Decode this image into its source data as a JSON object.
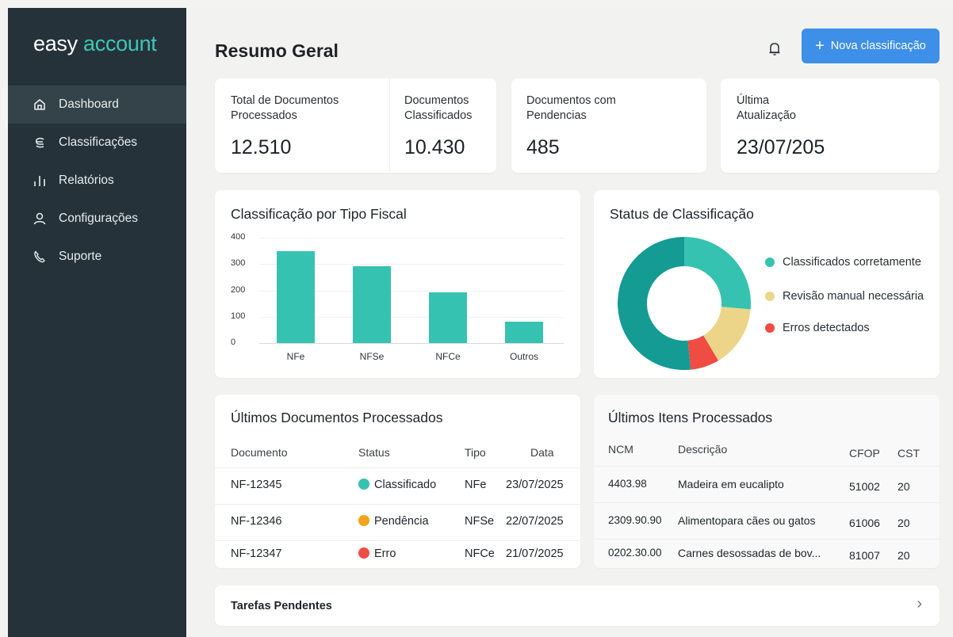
{
  "app": {
    "logo_a": "easy",
    "logo_b": "account"
  },
  "sidebar": {
    "items": [
      {
        "label": "Dashboard",
        "icon": "home-icon",
        "active": true
      },
      {
        "label": "Classificações",
        "icon": "tag-icon"
      },
      {
        "label": "Relatórios",
        "icon": "bar-chart-icon"
      },
      {
        "label": "Configurações",
        "icon": "user-icon"
      },
      {
        "label": "Suporte",
        "icon": "phone-icon"
      }
    ]
  },
  "header": {
    "title": "Resumo Geral",
    "new_button": "Nova classificação",
    "plus": "+"
  },
  "kpis": [
    {
      "label": "Total de Documentos Processados",
      "value": "12.510"
    },
    {
      "label": "Documentos Classificados",
      "value": "10.430"
    },
    {
      "label": "Documentos com Pendencias",
      "value": "485"
    },
    {
      "label": "Última Atualização",
      "value": "23/07/205"
    }
  ],
  "bar_chart": {
    "title": "Classificação por Tipo Fiscal",
    "chart_data": {
      "type": "bar",
      "categories": [
        "NFe",
        "NFSe",
        "NFCe",
        "Outros"
      ],
      "values": [
        350,
        292,
        192,
        82
      ],
      "ylim": [
        0,
        400
      ],
      "yticks": [
        "400",
        "300",
        "200",
        "100",
        "0"
      ],
      "color": "#36c2b0"
    }
  },
  "donut": {
    "title": "Status de Classificação",
    "chart_data": {
      "type": "pie",
      "categories": [
        "Classificados corretamente",
        "Revisão manual necessária",
        "Erros detectados"
      ],
      "values": [
        78,
        15,
        7
      ],
      "colors": [
        "#36c2b0",
        "#ecd588",
        "#ef4c43"
      ],
      "legend": "right"
    }
  },
  "docs_table": {
    "title": "Últimos Documentos Processados",
    "headers": [
      "Documento",
      "Status",
      "Tipo",
      "Data"
    ],
    "rows": [
      {
        "doc": "NF-12345",
        "status": "Classificado",
        "status_color": "#36c2b0",
        "tipo": "NFe",
        "data": "23/07/2025"
      },
      {
        "doc": "NF-12346",
        "status": "Pendência",
        "status_color": "#f3a41d",
        "tipo": "NFSe",
        "data": "22/07/2025"
      },
      {
        "doc": "NF-12347",
        "status": "Erro",
        "status_color": "#ef4c43",
        "tipo": "NFCe",
        "data": "21/07/2025"
      }
    ]
  },
  "items_table": {
    "title": "Últimos Itens Processados",
    "headers": [
      "NCM",
      "Descrição",
      "CFOP",
      "CST"
    ],
    "rows": [
      {
        "ncm": "4403.98",
        "desc": "Madeira em eucalipto",
        "cfop": "51002",
        "cst": "20"
      },
      {
        "ncm": "2309.90.90",
        "desc": "Alimentopara cães ou gatos",
        "cfop": "61006",
        "cst": "20"
      },
      {
        "ncm": "0202.30.00",
        "desc": "Carnes desossadas de bov...",
        "cfop": "81007",
        "cst": "20"
      }
    ]
  },
  "tasks": {
    "title": "Tarefas Pendentes",
    "chevron": "›"
  }
}
